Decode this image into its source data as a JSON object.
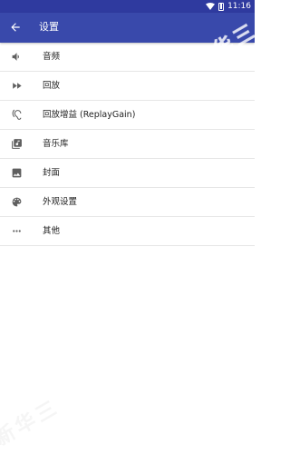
{
  "status_bar": {
    "time": "11:16"
  },
  "app_bar": {
    "title": "设置",
    "back_icon": "arrow-left-icon"
  },
  "settings_items": [
    {
      "label": "音频",
      "icon": "volume-icon"
    },
    {
      "label": "回放",
      "icon": "fast-forward-icon"
    },
    {
      "label": "回放增益 (ReplayGain)",
      "icon": "ear-icon"
    },
    {
      "label": "音乐库",
      "icon": "library-music-icon"
    },
    {
      "label": "封面",
      "icon": "image-icon"
    },
    {
      "label": "外观设置",
      "icon": "palette-icon"
    },
    {
      "label": "其他",
      "icon": "more-horiz-icon"
    }
  ],
  "watermark": {
    "top_right": "新华三",
    "bottom_left": "新华三"
  },
  "colors": {
    "primary": "#3949AB",
    "primary_dark": "#2F3A9F",
    "text": "#222222",
    "icon": "#5f5f5f",
    "divider": "#e6e6e6"
  }
}
